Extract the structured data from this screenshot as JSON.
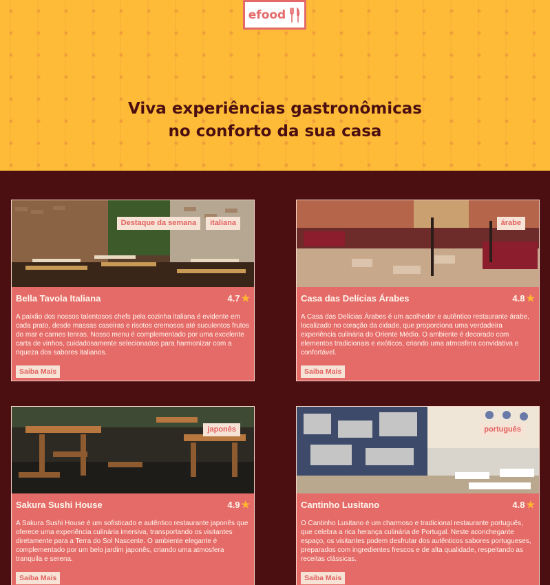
{
  "header": {
    "logo_text": "efood",
    "title_line1": "Viva experiências gastronômicas",
    "title_line2": "no conforto da sua casa"
  },
  "colors": {
    "hero_bg": "#fdbb37",
    "page_bg": "#4b0f12",
    "card_bg": "#e56b69",
    "tag_bg": "#f6e3d6",
    "accent": "#e2605e",
    "star": "#ffb930"
  },
  "restaurants": [
    {
      "name": "Bella Tavola Italiana",
      "rating": "4.7",
      "tags": [
        "Destaque da semana",
        "italiana"
      ],
      "description": "A paixão dos nossos talentosos chefs pela cozinha italiana é evidente em cada prato, desde massas caseiras e risotos cremosos até suculentos frutos do mar e carnes tenras. Nosso menu é complementado por uma excelente carta de vinhos, cuidadosamente selecionados para harmonizar com a riqueza dos sabores italianos.",
      "button": "Saiba Mais"
    },
    {
      "name": "Casa das Delícias Árabes",
      "rating": "4.8",
      "tags": [
        "árabe"
      ],
      "description": "A Casa das Delícias Árabes é um acolhedor e autêntico restaurante árabe, localizado no coração da cidade, que proporciona uma verdadeira experiência culinária do Oriente Médio. O ambiente é decorado com elementos tradicionais e exóticos, criando uma atmosfera convidativa e confortável.",
      "button": "Saiba Mais"
    },
    {
      "name": "Sakura Sushi House",
      "rating": "4.9",
      "tags": [
        "japonês"
      ],
      "description": "A Sakura Sushi House é um sofisticado e autêntico restaurante japonês que oferece uma experiência culinária imersiva, transportando os visitantes diretamente para a Terra do Sol Nascente. O ambiente elegante é complementado por um belo jardim japonês, criando uma atmosfera tranquila e serena.",
      "button": "Saiba Mais"
    },
    {
      "name": "Cantinho Lusitano",
      "rating": "4.8",
      "tags": [
        "português"
      ],
      "description": "O Cantinho Lusitano é um charmoso e tradicional restaurante português, que celebra a rica herança culinária de Portugal. Neste aconchegante espaço, os visitantes podem desfrutar dos autênticos sabores portugueses, preparados com ingredientes frescos e de alta qualidade, respeitando as receitas clássicas.",
      "button": "Saiba Mais"
    }
  ]
}
